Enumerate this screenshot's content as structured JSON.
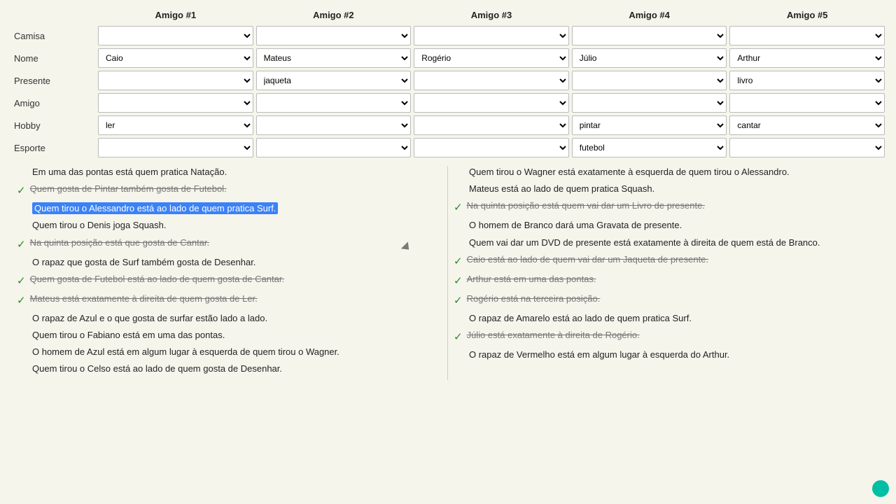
{
  "header": {
    "amigos": [
      "Amigo #1",
      "Amigo #2",
      "Amigo #3",
      "Amigo #4",
      "Amigo #5"
    ]
  },
  "rows": [
    {
      "label": "Camisa",
      "values": [
        "",
        "",
        "",
        "",
        ""
      ]
    },
    {
      "label": "Nome",
      "values": [
        "Caio",
        "Mateus",
        "Rogério",
        "Júlio",
        "Arthur"
      ]
    },
    {
      "label": "Presente",
      "values": [
        "",
        "jaqueta",
        "",
        "",
        "livro"
      ]
    },
    {
      "label": "Amigo",
      "values": [
        "",
        "",
        "",
        "",
        ""
      ]
    },
    {
      "label": "Hobby",
      "values": [
        "ler",
        "",
        "",
        "pintar",
        "cantar"
      ]
    },
    {
      "label": "Esporte",
      "values": [
        "",
        "",
        "",
        "futebol",
        ""
      ]
    }
  ],
  "clues_left": [
    {
      "id": "cl1",
      "checked": false,
      "style": "normal",
      "text": "Em uma das pontas está quem pratica Natação."
    },
    {
      "id": "cl2",
      "checked": true,
      "style": "strikethrough",
      "text": "Quem gosta de Pintar também gosta de Futebol."
    },
    {
      "id": "cl3",
      "checked": false,
      "style": "highlighted",
      "text": "Quem tirou o Alessandro está ao lado de quem pratica Surf."
    },
    {
      "id": "cl4",
      "checked": false,
      "style": "normal",
      "text": "Quem tirou o Denis joga Squash."
    },
    {
      "id": "cl5",
      "checked": true,
      "style": "strikethrough",
      "text": "Na quinta posição está que gosta de Cantar."
    },
    {
      "id": "cl6",
      "checked": false,
      "style": "normal",
      "text": "O rapaz que gosta de Surf também gosta de Desenhar."
    },
    {
      "id": "cl7",
      "checked": true,
      "style": "strikethrough",
      "text": "Quem gosta de Futebol está ao lado de quem gosta de Cantar."
    },
    {
      "id": "cl8",
      "checked": true,
      "style": "strikethrough",
      "text": "Mateus está exatamente à direita de quem gosta de Ler."
    },
    {
      "id": "cl9",
      "checked": false,
      "style": "normal",
      "text": "O rapaz de Azul e o que gosta de surfar estão lado a lado."
    },
    {
      "id": "cl10",
      "checked": false,
      "style": "normal",
      "text": "Quem tirou o Fabiano está em uma das pontas."
    },
    {
      "id": "cl11",
      "checked": false,
      "style": "normal",
      "text": "O homem de Azul está em algum lugar à esquerda de quem tirou o Wagner."
    },
    {
      "id": "cl12",
      "checked": false,
      "style": "normal",
      "text": "Quem tirou o Celso está ao lado de quem gosta de Desenhar."
    }
  ],
  "clues_right": [
    {
      "id": "cr1",
      "checked": false,
      "style": "normal",
      "text": "Quem tirou o Wagner está exatamente à esquerda de quem tirou o Alessandro."
    },
    {
      "id": "cr2",
      "checked": false,
      "style": "normal",
      "text": "Mateus está ao lado de quem pratica Squash."
    },
    {
      "id": "cr3",
      "checked": true,
      "style": "strikethrough",
      "text": "Na quinta posição está quem vai dar um Livro de presente."
    },
    {
      "id": "cr4",
      "checked": false,
      "style": "normal",
      "text": "O homem de Branco dará uma Gravata de presente."
    },
    {
      "id": "cr5",
      "checked": false,
      "style": "normal",
      "text": "Quem vai dar um DVD de presente está exatamente à direita de quem está de Branco."
    },
    {
      "id": "cr6",
      "checked": true,
      "style": "strikethrough",
      "text": "Caio está ao lado de quem vai dar um Jaqueta de presente."
    },
    {
      "id": "cr7",
      "checked": true,
      "style": "strikethrough",
      "text": "Arthur está em uma das pontas."
    },
    {
      "id": "cr8",
      "checked": true,
      "style": "strikethrough",
      "text": "Rogério está na terceira posição."
    },
    {
      "id": "cr9",
      "checked": false,
      "style": "normal",
      "text": "O rapaz de Amarelo está ao lado de quem pratica Surf."
    },
    {
      "id": "cr10",
      "checked": true,
      "style": "strikethrough",
      "text": "Júlio está exatamente à direita de Rogério."
    },
    {
      "id": "cr11",
      "checked": false,
      "style": "normal",
      "text": "O rapaz de Vermelho está em algum lugar à esquerda do Arthur."
    }
  ]
}
